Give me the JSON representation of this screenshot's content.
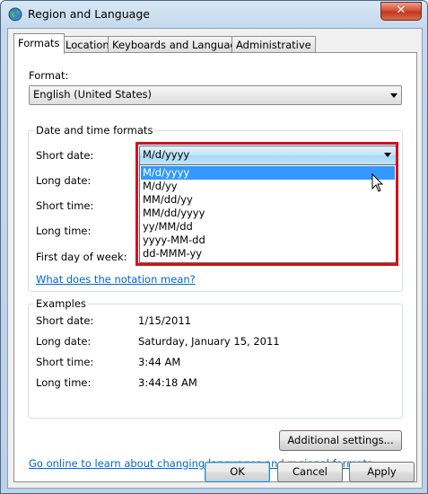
{
  "window": {
    "title": "Region and Language",
    "close_symbol": "✕"
  },
  "tabs": [
    {
      "label": "Formats",
      "active": true
    },
    {
      "label": "Location",
      "active": false
    },
    {
      "label": "Keyboards and Languages",
      "active": false
    },
    {
      "label": "Administrative",
      "active": false
    }
  ],
  "format": {
    "label": "Format:",
    "value": "English (United States)"
  },
  "date_time": {
    "group_label": "Date and time formats",
    "short_date_label": "Short date:",
    "long_date_label": "Long date:",
    "short_time_label": "Short time:",
    "long_time_label": "Long time:",
    "first_day_label": "First day of week:",
    "short_date_value": "M/d/yyyy",
    "short_date_options": [
      "M/d/yyyy",
      "M/d/yy",
      "MM/dd/yy",
      "MM/dd/yyyy",
      "yy/MM/dd",
      "yyyy-MM-dd",
      "dd-MMM-yy"
    ],
    "notation_link": "What does the notation mean?"
  },
  "examples": {
    "group_label": "Examples",
    "short_date_label": "Short date:",
    "short_date_value": "1/15/2011",
    "long_date_label": "Long date:",
    "long_date_value": "Saturday, January 15, 2011",
    "short_time_label": "Short time:",
    "short_time_value": "3:44 AM",
    "long_time_label": "Long time:",
    "long_time_value": "3:44:18 AM"
  },
  "additional_settings_label": "Additional settings...",
  "online_link": "Go online to learn about changing languages and regional formats",
  "buttons": {
    "ok": "OK",
    "cancel": "Cancel",
    "apply": "Apply"
  },
  "colors": {
    "selection": "#3399ff",
    "highlight_border": "#d4111a",
    "link": "#0066cc"
  }
}
